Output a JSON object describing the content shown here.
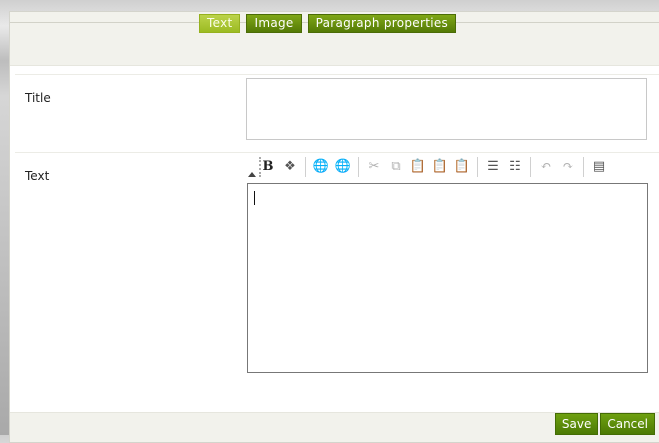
{
  "tabs": [
    {
      "label": "Text",
      "active": true
    },
    {
      "label": "Image",
      "active": false
    },
    {
      "label": "Paragraph properties",
      "active": false
    }
  ],
  "fields": {
    "title_label": "Title",
    "title_value": "",
    "text_label": "Text",
    "text_value": ""
  },
  "toolbar": {
    "items": [
      "collapse-icon",
      "bold-icon",
      "style-icon",
      "link-icon",
      "unlink-icon",
      "cut-icon",
      "copy-icon",
      "paste-icon",
      "paste-text-icon",
      "paste-word-icon",
      "numbered-list-icon",
      "bulleted-list-icon",
      "undo-icon",
      "redo-icon",
      "source-icon"
    ]
  },
  "actions": {
    "save_label": "Save",
    "cancel_label": "Cancel"
  },
  "colors": {
    "tab_active": "#a8c52e",
    "tab_inactive": "#5e8a0a",
    "button": "#5a8a08"
  }
}
